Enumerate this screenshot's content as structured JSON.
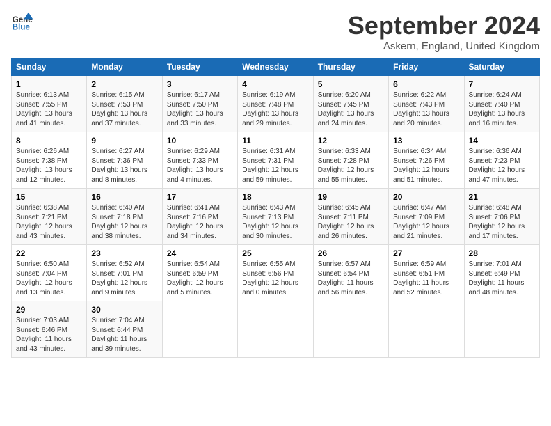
{
  "logo": {
    "line1": "General",
    "line2": "Blue"
  },
  "title": "September 2024",
  "location": "Askern, England, United Kingdom",
  "days_of_week": [
    "Sunday",
    "Monday",
    "Tuesday",
    "Wednesday",
    "Thursday",
    "Friday",
    "Saturday"
  ],
  "weeks": [
    [
      {
        "day": "1",
        "text": "Sunrise: 6:13 AM\nSunset: 7:55 PM\nDaylight: 13 hours\nand 41 minutes."
      },
      {
        "day": "2",
        "text": "Sunrise: 6:15 AM\nSunset: 7:53 PM\nDaylight: 13 hours\nand 37 minutes."
      },
      {
        "day": "3",
        "text": "Sunrise: 6:17 AM\nSunset: 7:50 PM\nDaylight: 13 hours\nand 33 minutes."
      },
      {
        "day": "4",
        "text": "Sunrise: 6:19 AM\nSunset: 7:48 PM\nDaylight: 13 hours\nand 29 minutes."
      },
      {
        "day": "5",
        "text": "Sunrise: 6:20 AM\nSunset: 7:45 PM\nDaylight: 13 hours\nand 24 minutes."
      },
      {
        "day": "6",
        "text": "Sunrise: 6:22 AM\nSunset: 7:43 PM\nDaylight: 13 hours\nand 20 minutes."
      },
      {
        "day": "7",
        "text": "Sunrise: 6:24 AM\nSunset: 7:40 PM\nDaylight: 13 hours\nand 16 minutes."
      }
    ],
    [
      {
        "day": "8",
        "text": "Sunrise: 6:26 AM\nSunset: 7:38 PM\nDaylight: 13 hours\nand 12 minutes."
      },
      {
        "day": "9",
        "text": "Sunrise: 6:27 AM\nSunset: 7:36 PM\nDaylight: 13 hours\nand 8 minutes."
      },
      {
        "day": "10",
        "text": "Sunrise: 6:29 AM\nSunset: 7:33 PM\nDaylight: 13 hours\nand 4 minutes."
      },
      {
        "day": "11",
        "text": "Sunrise: 6:31 AM\nSunset: 7:31 PM\nDaylight: 12 hours\nand 59 minutes."
      },
      {
        "day": "12",
        "text": "Sunrise: 6:33 AM\nSunset: 7:28 PM\nDaylight: 12 hours\nand 55 minutes."
      },
      {
        "day": "13",
        "text": "Sunrise: 6:34 AM\nSunset: 7:26 PM\nDaylight: 12 hours\nand 51 minutes."
      },
      {
        "day": "14",
        "text": "Sunrise: 6:36 AM\nSunset: 7:23 PM\nDaylight: 12 hours\nand 47 minutes."
      }
    ],
    [
      {
        "day": "15",
        "text": "Sunrise: 6:38 AM\nSunset: 7:21 PM\nDaylight: 12 hours\nand 43 minutes."
      },
      {
        "day": "16",
        "text": "Sunrise: 6:40 AM\nSunset: 7:18 PM\nDaylight: 12 hours\nand 38 minutes."
      },
      {
        "day": "17",
        "text": "Sunrise: 6:41 AM\nSunset: 7:16 PM\nDaylight: 12 hours\nand 34 minutes."
      },
      {
        "day": "18",
        "text": "Sunrise: 6:43 AM\nSunset: 7:13 PM\nDaylight: 12 hours\nand 30 minutes."
      },
      {
        "day": "19",
        "text": "Sunrise: 6:45 AM\nSunset: 7:11 PM\nDaylight: 12 hours\nand 26 minutes."
      },
      {
        "day": "20",
        "text": "Sunrise: 6:47 AM\nSunset: 7:09 PM\nDaylight: 12 hours\nand 21 minutes."
      },
      {
        "day": "21",
        "text": "Sunrise: 6:48 AM\nSunset: 7:06 PM\nDaylight: 12 hours\nand 17 minutes."
      }
    ],
    [
      {
        "day": "22",
        "text": "Sunrise: 6:50 AM\nSunset: 7:04 PM\nDaylight: 12 hours\nand 13 minutes."
      },
      {
        "day": "23",
        "text": "Sunrise: 6:52 AM\nSunset: 7:01 PM\nDaylight: 12 hours\nand 9 minutes."
      },
      {
        "day": "24",
        "text": "Sunrise: 6:54 AM\nSunset: 6:59 PM\nDaylight: 12 hours\nand 5 minutes."
      },
      {
        "day": "25",
        "text": "Sunrise: 6:55 AM\nSunset: 6:56 PM\nDaylight: 12 hours\nand 0 minutes."
      },
      {
        "day": "26",
        "text": "Sunrise: 6:57 AM\nSunset: 6:54 PM\nDaylight: 11 hours\nand 56 minutes."
      },
      {
        "day": "27",
        "text": "Sunrise: 6:59 AM\nSunset: 6:51 PM\nDaylight: 11 hours\nand 52 minutes."
      },
      {
        "day": "28",
        "text": "Sunrise: 7:01 AM\nSunset: 6:49 PM\nDaylight: 11 hours\nand 48 minutes."
      }
    ],
    [
      {
        "day": "29",
        "text": "Sunrise: 7:03 AM\nSunset: 6:46 PM\nDaylight: 11 hours\nand 43 minutes."
      },
      {
        "day": "30",
        "text": "Sunrise: 7:04 AM\nSunset: 6:44 PM\nDaylight: 11 hours\nand 39 minutes."
      },
      {
        "day": "",
        "text": ""
      },
      {
        "day": "",
        "text": ""
      },
      {
        "day": "",
        "text": ""
      },
      {
        "day": "",
        "text": ""
      },
      {
        "day": "",
        "text": ""
      }
    ]
  ]
}
